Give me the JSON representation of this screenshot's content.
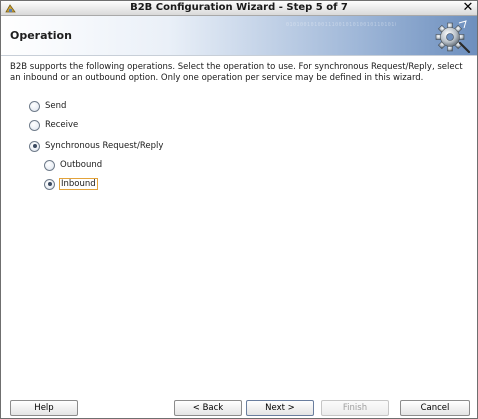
{
  "window": {
    "title": "B2B Configuration Wizard - Step 5 of 7"
  },
  "header": {
    "title": "Operation",
    "pattern_text": "0101001010011100101010010110101001010100101101010100101001010100110101001010100101010100101101010010101010010101101001010100101010101001010010101010"
  },
  "description": "B2B supports the following operations.  Select the operation to use.  For synchronous Request/Reply, select an inbound or an outbound option. Only one operation per service may be defined in this wizard.",
  "operations": {
    "send": {
      "label": "Send",
      "checked": false
    },
    "receive": {
      "label": "Receive",
      "checked": false
    },
    "sync": {
      "label": "Synchronous Request/Reply",
      "checked": true
    },
    "outbound": {
      "label": "Outbound",
      "checked": false
    },
    "inbound": {
      "label": "Inbound",
      "checked": true
    }
  },
  "buttons": {
    "help": "Help",
    "back": "< Back",
    "next": "Next >",
    "finish": "Finish",
    "cancel": "Cancel"
  },
  "icons": {
    "app": "app-icon",
    "close": "close-icon",
    "header": "gear-wizard-icon"
  }
}
